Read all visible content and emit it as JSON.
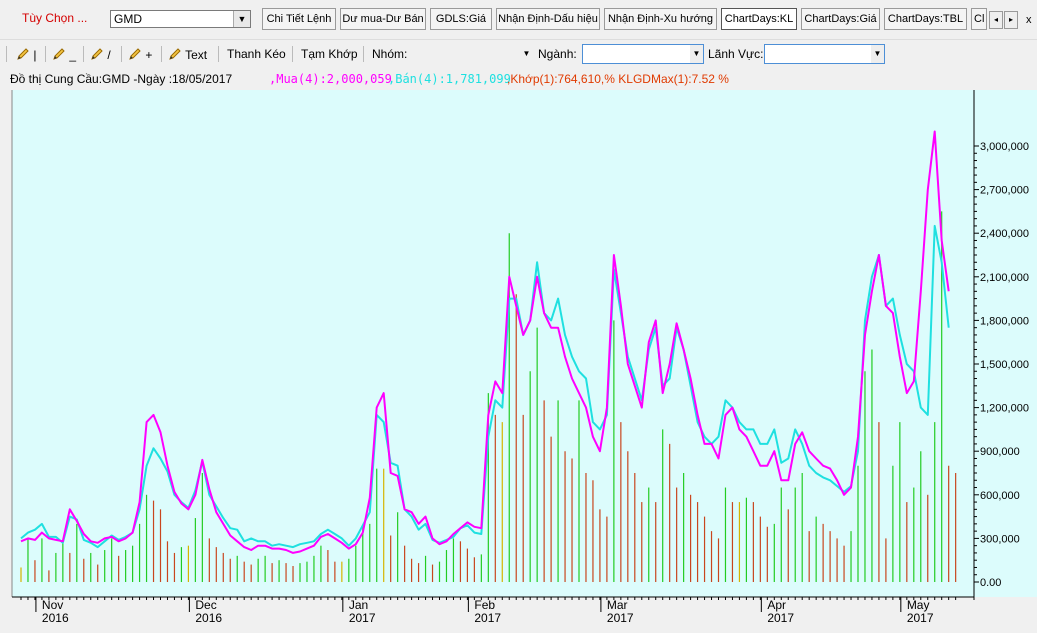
{
  "options_label": "Tùy Chọn ...",
  "symbol": "GMD",
  "tabs": [
    "Chi Tiết Lệnh",
    "Dư mua-Dư Bán",
    "GDLS:Giá",
    "Nhận Định-Dấu hiệu",
    "Nhận Định-Xu hướng",
    "ChartDays:KL",
    "ChartDays:Giá",
    "ChartDays:TBL",
    "Cl"
  ],
  "active_tab": "ChartDays:KL",
  "nav_prev": "◂",
  "nav_next": "▸",
  "close": "x",
  "toolbar": {
    "draw1": "|",
    "draw2": "_",
    "draw3": "/",
    "draw4": "+",
    "text": "Text",
    "thanh_keo": "Thanh Kéo",
    "tam_khop": "Tạm Khớp",
    "nhom_label": "Nhóm:",
    "nganh_label": "Ngành:",
    "linh_vuc_label": "Lãnh Vực:",
    "nhom_value": "",
    "nganh_value": "",
    "linh_vuc_value": ""
  },
  "colors": {
    "buy": "#ff00ff",
    "sell": "#1fe0e0",
    "bar_up": "#22cc22",
    "bar_down": "#c8461e",
    "bar_ref": "#d6b400",
    "plot_bg": "#dcfcfc"
  },
  "chart_data": {
    "type": "line",
    "title": "Đồ thị Cung Cầu:GMD -Ngày :18/05/2017",
    "legend": {
      "mua": ",Mua(4):2,000,059",
      "ban": ",Bán(4):1,781,099",
      "khop": ",Khớp(1):764,610,% KLGDMax(1):7.52 %"
    },
    "ylim": [
      0,
      3000000
    ],
    "y_ticks": [
      "0.00",
      "300,000",
      "600,000",
      "900,000",
      "1,200,000",
      "1,500,000",
      "1,800,000",
      "2,100,000",
      "2,400,000",
      "2,700,000",
      "3,000,000"
    ],
    "x_month_labels": [
      {
        "index": 3,
        "month": "Nov",
        "year": "2016"
      },
      {
        "index": 25,
        "month": "Dec",
        "year": "2016"
      },
      {
        "index": 47,
        "month": "Jan",
        "year": "2017"
      },
      {
        "index": 65,
        "month": "Feb",
        "year": "2017"
      },
      {
        "index": 84,
        "month": "Mar",
        "year": "2017"
      },
      {
        "index": 107,
        "month": "Apr",
        "year": "2017"
      },
      {
        "index": 127,
        "month": "May",
        "year": "2017"
      }
    ],
    "series": [
      {
        "name": "Mua(4)",
        "color": "#ff00ff",
        "values": [
          280000,
          300000,
          290000,
          340000,
          300000,
          290000,
          280000,
          500000,
          420000,
          330000,
          280000,
          270000,
          300000,
          310000,
          280000,
          300000,
          340000,
          550000,
          1100000,
          1150000,
          1030000,
          800000,
          620000,
          540000,
          500000,
          600000,
          840000,
          640000,
          480000,
          400000,
          320000,
          280000,
          240000,
          220000,
          250000,
          250000,
          230000,
          230000,
          220000,
          200000,
          210000,
          230000,
          250000,
          310000,
          330000,
          300000,
          270000,
          230000,
          260000,
          340000,
          580000,
          1200000,
          1300000,
          750000,
          730000,
          500000,
          480000,
          400000,
          450000,
          300000,
          260000,
          280000,
          330000,
          370000,
          410000,
          380000,
          370000,
          1150000,
          1380000,
          1300000,
          2100000,
          1900000,
          1700000,
          1800000,
          2100000,
          1850000,
          1750000,
          1750000,
          1550000,
          1400000,
          1300000,
          1200000,
          1000000,
          900000,
          1200000,
          2250000,
          1900000,
          1500000,
          1350000,
          1200000,
          1650000,
          1800000,
          1300000,
          1500000,
          1780000,
          1600000,
          1400000,
          1150000,
          950000,
          950000,
          850000,
          1150000,
          1200000,
          1050000,
          1000000,
          900000,
          800000,
          800000,
          900000,
          700000,
          700000,
          950000,
          1030000,
          900000,
          850000,
          800000,
          780000,
          700000,
          600000,
          650000,
          1000000,
          1700000,
          2000000,
          2250000,
          1900000,
          1850000,
          1550000,
          1300000,
          1380000,
          2000000,
          2700000,
          3100000,
          2350000,
          2000000
        ]
      },
      {
        "name": "Bán(4)",
        "color": "#1fe0e0",
        "values": [
          300000,
          340000,
          360000,
          400000,
          310000,
          310000,
          270000,
          450000,
          430000,
          290000,
          270000,
          240000,
          280000,
          320000,
          290000,
          310000,
          340000,
          500000,
          800000,
          920000,
          850000,
          760000,
          600000,
          550000,
          510000,
          630000,
          830000,
          600000,
          520000,
          440000,
          370000,
          360000,
          280000,
          300000,
          280000,
          280000,
          250000,
          260000,
          250000,
          240000,
          260000,
          270000,
          280000,
          330000,
          360000,
          330000,
          300000,
          250000,
          300000,
          390000,
          480000,
          1150000,
          1100000,
          820000,
          800000,
          500000,
          450000,
          360000,
          400000,
          290000,
          270000,
          290000,
          310000,
          370000,
          390000,
          340000,
          330000,
          1000000,
          1250000,
          1200000,
          1950000,
          1950000,
          1700000,
          1800000,
          2200000,
          1850000,
          1800000,
          1950000,
          1700000,
          1550000,
          1450000,
          1400000,
          1100000,
          1050000,
          1150000,
          2150000,
          1850000,
          1550000,
          1400000,
          1250000,
          1600000,
          1750000,
          1350000,
          1400000,
          1750000,
          1600000,
          1350000,
          1100000,
          1000000,
          950000,
          1000000,
          1250000,
          1200000,
          1100000,
          1050000,
          1050000,
          950000,
          950000,
          1050000,
          820000,
          850000,
          1050000,
          950000,
          800000,
          750000,
          720000,
          700000,
          660000,
          620000,
          660000,
          900000,
          1800000,
          2100000,
          2250000,
          1900000,
          1950000,
          1700000,
          1500000,
          1450000,
          1200000,
          1150000,
          2450000,
          2200000,
          1750000
        ]
      },
      {
        "name": "Khớp",
        "kind": "bar",
        "values": [
          100000,
          300000,
          150000,
          300000,
          80000,
          200000,
          280000,
          200000,
          400000,
          160000,
          200000,
          120000,
          220000,
          300000,
          180000,
          220000,
          250000,
          400000,
          600000,
          560000,
          500000,
          280000,
          200000,
          240000,
          250000,
          440000,
          750000,
          300000,
          240000,
          200000,
          160000,
          180000,
          140000,
          120000,
          160000,
          180000,
          130000,
          150000,
          130000,
          110000,
          130000,
          140000,
          180000,
          250000,
          220000,
          140000,
          140000,
          160000,
          250000,
          380000,
          400000,
          780000,
          780000,
          320000,
          480000,
          250000,
          160000,
          130000,
          180000,
          120000,
          140000,
          220000,
          300000,
          280000,
          230000,
          170000,
          190000,
          1300000,
          1150000,
          1100000,
          2400000,
          1980000,
          1150000,
          1450000,
          1750000,
          1250000,
          1000000,
          1250000,
          900000,
          850000,
          1250000,
          750000,
          700000,
          500000,
          450000,
          1800000,
          1100000,
          900000,
          750000,
          550000,
          650000,
          550000,
          1050000,
          950000,
          650000,
          750000,
          600000,
          550000,
          450000,
          350000,
          300000,
          650000,
          550000,
          550000,
          580000,
          550000,
          450000,
          380000,
          400000,
          650000,
          500000,
          650000,
          750000,
          350000,
          450000,
          400000,
          350000,
          300000,
          250000,
          350000,
          800000,
          1450000,
          1600000,
          1100000,
          300000,
          800000,
          1100000,
          550000,
          650000,
          900000,
          600000,
          1100000,
          2550000,
          800000,
          750000
        ]
      }
    ]
  }
}
